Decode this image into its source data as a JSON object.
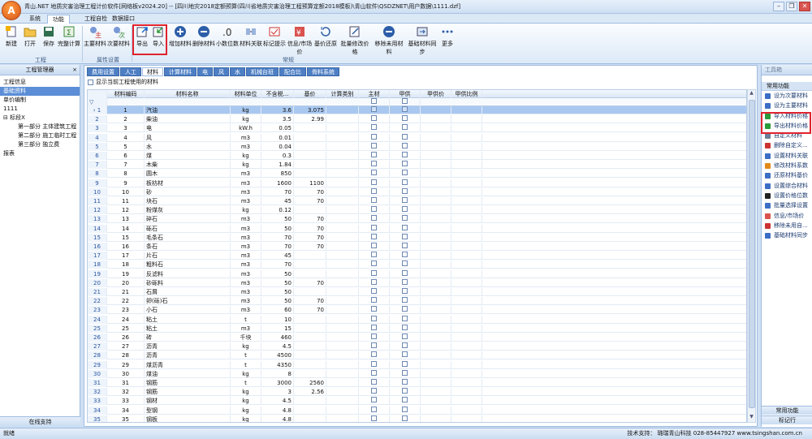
{
  "titlebar": {
    "title": "青山.NET 地质灾害治理工程计价软件[网络板v2024.20] -- [四川地灾2018定额预算(四川省地质灾害治理工程预算定额2018模板)\\青山软件\\QSDZNET\\用户数据\\1111.dzf]"
  },
  "menu": {
    "tabs": [
      "系统",
      "功能",
      "工程自检",
      "数据接口"
    ],
    "active": 1
  },
  "ribbon": {
    "buttons": [
      "新建",
      "打开",
      "保存",
      "完整计算",
      "主要材料",
      "次要材料",
      "导出",
      "导入",
      "增加材料",
      "删除材料",
      "小数位数",
      "材料关联",
      "标记提示",
      "信息/市场价",
      "基价还原",
      "批量修改价格",
      "移除未用材料",
      "基础材料同步",
      "更多"
    ],
    "groups": [
      "工程",
      "属性设置",
      "常规"
    ]
  },
  "left_panel": {
    "title": "工程管理器",
    "items": [
      "工程信息",
      "基础资料",
      "单价编制",
      "1111",
      "标段X",
      "第一部分 主体建筑工程",
      "第二部分 施工临时工程",
      "第三部分 独立费",
      "报表"
    ],
    "bottom": "在线支持"
  },
  "main": {
    "sheet_tabs": [
      "费用设置",
      "人工",
      "材料",
      "计算材料",
      "电",
      "风",
      "水",
      "机械台班",
      "配合比",
      "骨料系统"
    ],
    "active_tab": 2,
    "only_used_label": "显示当前工程使用的材料",
    "columns": [
      "材料编码",
      "材料名称",
      "材料单位",
      "不含税...",
      "基价",
      "计算类别",
      "主材",
      "甲供",
      "甲供价",
      "甲供比例"
    ],
    "rows": [
      [
        "1",
        "1",
        "汽油",
        "kg",
        "3.6",
        "3.075"
      ],
      [
        "2",
        "2",
        "柴油",
        "kg",
        "3.5",
        "2.99"
      ],
      [
        "3",
        "3",
        "电",
        "kW.h",
        "0.05",
        ""
      ],
      [
        "4",
        "4",
        "风",
        "m3",
        "0.01",
        ""
      ],
      [
        "5",
        "5",
        "水",
        "m3",
        "0.04",
        ""
      ],
      [
        "6",
        "6",
        "煤",
        "kg",
        "0.3",
        ""
      ],
      [
        "7",
        "7",
        "木柴",
        "kg",
        "1.84",
        ""
      ],
      [
        "8",
        "8",
        "圆木",
        "m3",
        "850",
        ""
      ],
      [
        "9",
        "9",
        "板枋材",
        "m3",
        "1600",
        "1100"
      ],
      [
        "10",
        "10",
        "砂",
        "m3",
        "70",
        "70"
      ],
      [
        "11",
        "11",
        "块石",
        "m3",
        "45",
        "70"
      ],
      [
        "12",
        "12",
        "粉煤灰",
        "kg",
        "0.12",
        ""
      ],
      [
        "13",
        "13",
        "碎石",
        "m3",
        "50",
        "70"
      ],
      [
        "14",
        "14",
        "砾石",
        "m3",
        "50",
        "70"
      ],
      [
        "15",
        "15",
        "毛条石",
        "m3",
        "70",
        "70"
      ],
      [
        "16",
        "16",
        "条石",
        "m3",
        "70",
        "70"
      ],
      [
        "17",
        "17",
        "片石",
        "m3",
        "45",
        ""
      ],
      [
        "18",
        "18",
        "粗料石",
        "m3",
        "70",
        ""
      ],
      [
        "19",
        "19",
        "反滤料",
        "m3",
        "50",
        ""
      ],
      [
        "20",
        "20",
        "砂砾料",
        "m3",
        "50",
        "70"
      ],
      [
        "21",
        "21",
        "石屑",
        "m3",
        "50",
        ""
      ],
      [
        "22",
        "22",
        "卵(砾)石",
        "m3",
        "50",
        "70"
      ],
      [
        "23",
        "23",
        "小石",
        "m3",
        "60",
        "70"
      ],
      [
        "24",
        "24",
        "粘土",
        "t",
        "10",
        ""
      ],
      [
        "25",
        "25",
        "粘土",
        "m3",
        "15",
        ""
      ],
      [
        "26",
        "26",
        "砖",
        "千块",
        "460",
        ""
      ],
      [
        "27",
        "27",
        "沥青",
        "kg",
        "4.5",
        ""
      ],
      [
        "28",
        "28",
        "沥青",
        "t",
        "4500",
        ""
      ],
      [
        "29",
        "29",
        "煤沥青",
        "t",
        "4350",
        ""
      ],
      [
        "30",
        "30",
        "煤油",
        "kg",
        "8",
        ""
      ],
      [
        "31",
        "31",
        "钢筋",
        "t",
        "3000",
        "2560"
      ],
      [
        "32",
        "32",
        "钢筋",
        "kg",
        "3",
        "2.56"
      ],
      [
        "33",
        "33",
        "钢材",
        "kg",
        "4.5",
        ""
      ],
      [
        "34",
        "34",
        "型钢",
        "kg",
        "4.8",
        ""
      ],
      [
        "35",
        "35",
        "钢板",
        "kg",
        "4.8",
        ""
      ]
    ]
  },
  "right_panel": {
    "title": "工具箱",
    "section": "常用功能",
    "items": [
      "设为次要材料",
      "设为主要材料",
      "导入材料价格",
      "导出材料价格",
      "自定义材料",
      "删除自定义...",
      "设置材料关联",
      "修改材料系数",
      "还原材料基价",
      "设置综合材料",
      "设置价格位数",
      "批量选择设置",
      "信息/市场价",
      "移除未用自...",
      "基础材料同步"
    ],
    "bottom1": "常用功能",
    "bottom2": "标记行"
  },
  "status": {
    "left": "就绪",
    "right": "技术支持：  璐瑞青山科技  028-85447927  www.tsingshan.com.cn"
  }
}
